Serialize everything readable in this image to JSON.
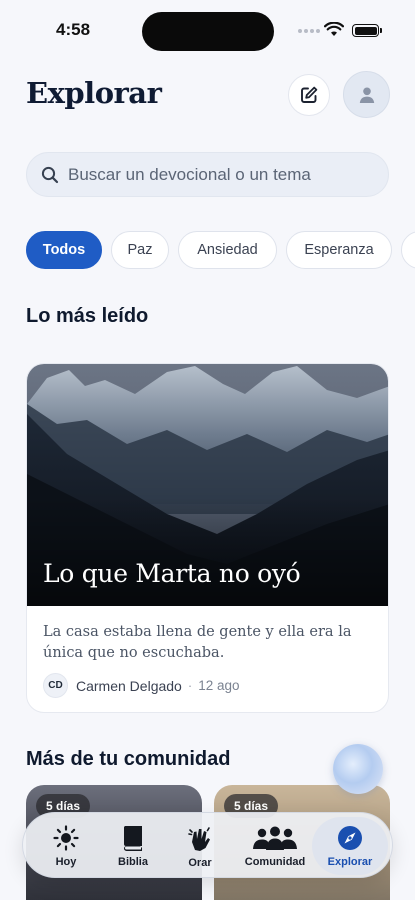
{
  "status_bar": {
    "time": "4:58"
  },
  "header": {
    "title": "Explorar"
  },
  "search": {
    "placeholder": "Buscar un devocional o un tema"
  },
  "filters": [
    "Todos",
    "Paz",
    "Ansiedad",
    "Esperanza"
  ],
  "sections": {
    "most_read": "Lo más leído",
    "community": "Más de tu comunidad"
  },
  "featured": {
    "title": "Lo que Marta no oyó",
    "description": "La casa estaba llena de gente y ella era la única que no escuchaba.",
    "author_initials": "CD",
    "author": "Carmen Delgado",
    "separator": "·",
    "date": "12 ago"
  },
  "community_cards": [
    {
      "badge": "5 días"
    },
    {
      "badge": "5 días"
    }
  ],
  "tabs": [
    {
      "label": "Hoy",
      "icon": "sun-icon"
    },
    {
      "label": "Biblia",
      "icon": "book-icon"
    },
    {
      "label": "Orar",
      "icon": "praying-hands-icon"
    },
    {
      "label": "Comunidad",
      "icon": "people-icon"
    },
    {
      "label": "Explorar",
      "icon": "compass-icon",
      "active": true
    }
  ],
  "colors": {
    "accent": "#1f5cc5",
    "active_tab_text": "#1a4fb0",
    "background": "#f6f7fb"
  }
}
